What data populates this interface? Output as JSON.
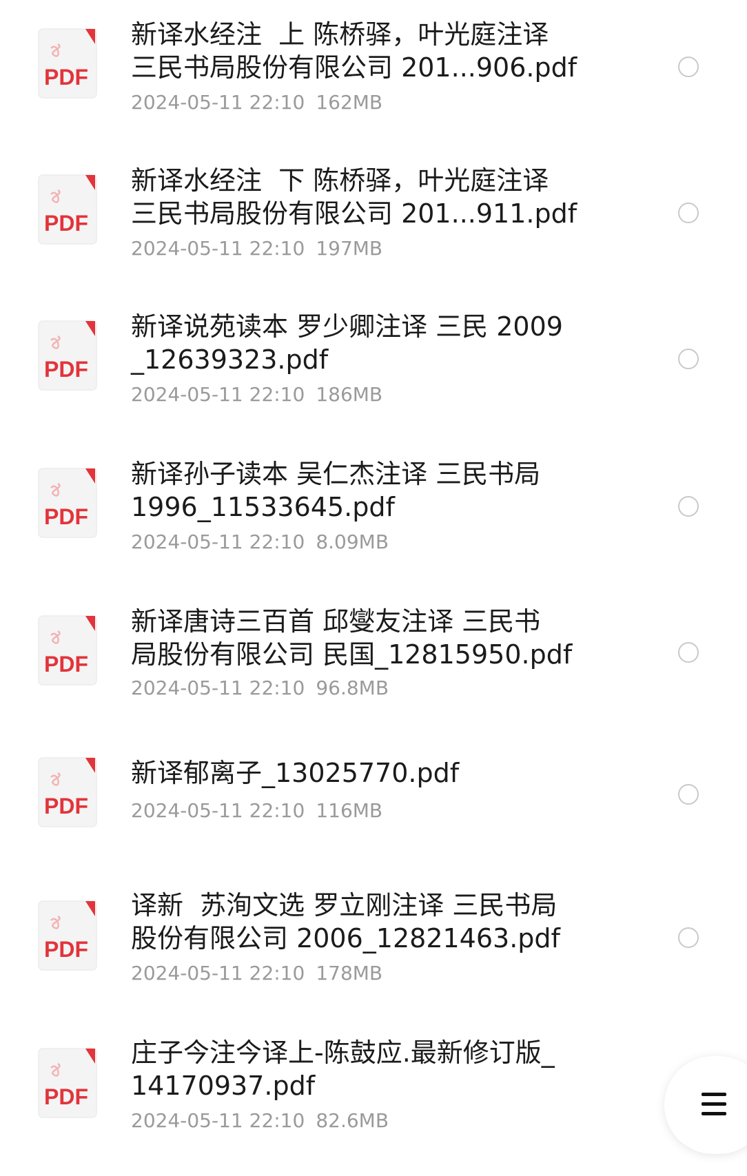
{
  "colors": {
    "pdf_red": "#e2343b",
    "pdf_red_light": "#f3b3b5",
    "pdf_bg": "#f4f4f4",
    "text_primary": "#1b1b1b",
    "text_meta": "#9a9a9a",
    "radio_border": "#c9c9c9"
  },
  "icons": {
    "file": "pdf-icon",
    "select": "radio-circle-icon",
    "menu": "menu-icon"
  },
  "pdf_label": "PDF",
  "files": [
    {
      "name_line1": "新译水经注  上 陈桥驿，叶光庭注译",
      "name_line2": "三民书局股份有限公司 201...906.pdf",
      "date": "2024-05-11 22:10",
      "size": "162MB"
    },
    {
      "name_line1": "新译水经注  下 陈桥驿，叶光庭注译",
      "name_line2": "三民书局股份有限公司 201...911.pdf",
      "date": "2024-05-11 22:10",
      "size": "197MB"
    },
    {
      "name_line1": "新译说苑读本 罗少卿注译 三民 2009",
      "name_line2": "_12639323.pdf",
      "date": "2024-05-11 22:10",
      "size": "186MB"
    },
    {
      "name_line1": "新译孙子读本 吴仁杰注译 三民书局",
      "name_line2": "1996_11533645.pdf",
      "date": "2024-05-11 22:10",
      "size": "8.09MB"
    },
    {
      "name_line1": "新译唐诗三百首 邱燮友注译 三民书",
      "name_line2": "局股份有限公司 民国_12815950.pdf",
      "date": "2024-05-11 22:10",
      "size": "96.8MB"
    },
    {
      "name_line1": "新译郁离子_13025770.pdf",
      "name_line2": "",
      "date": "2024-05-11 22:10",
      "size": "116MB"
    },
    {
      "name_line1": "译新  苏洵文选 罗立刚注译 三民书局",
      "name_line2": "股份有限公司 2006_12821463.pdf",
      "date": "2024-05-11 22:10",
      "size": "178MB"
    },
    {
      "name_line1": "庄子今注今译上-陈鼓应.最新修订版_",
      "name_line2": "14170937.pdf",
      "date": "2024-05-11 22:10",
      "size": "82.6MB"
    }
  ]
}
